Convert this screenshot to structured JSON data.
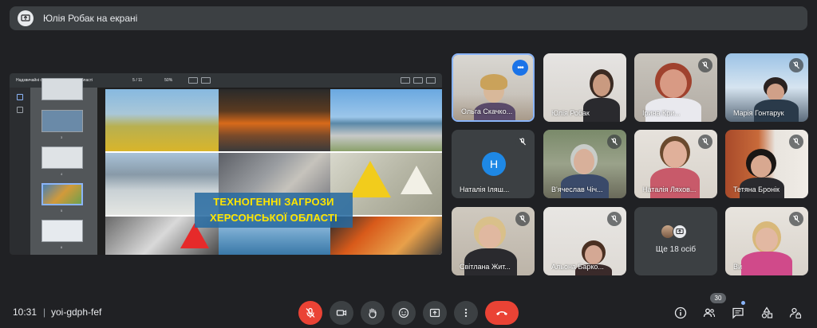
{
  "presenter": {
    "label": "Юлія Робак на екрані"
  },
  "pdf": {
    "title": "Надзвичайні ситуації херсонської області",
    "page_indicator": "5 / 11",
    "zoom": "50%",
    "thumb_numbers": [
      "3",
      "4",
      "5",
      "6"
    ]
  },
  "slide": {
    "title_line1": "ТЕХНОГЕННІ ЗАГРОЗИ",
    "title_line2": "ХЕРСОНСЬКОЇ ОБЛАСТІ"
  },
  "participants": [
    {
      "name": "Ольга Скачко...",
      "muted": false,
      "active": true
    },
    {
      "name": "Юлія Робак",
      "muted": false
    },
    {
      "name": "Ірина Кри...",
      "muted": true
    },
    {
      "name": "Марія Гонтарук",
      "muted": true
    },
    {
      "name": "Наталія Іляш...",
      "muted": true,
      "initial": "Н"
    },
    {
      "name": "В'ячеслав Чіч...",
      "muted": true
    },
    {
      "name": "Наталія Ляхов...",
      "muted": true
    },
    {
      "name": "Тетяна Бронік",
      "muted": true
    },
    {
      "name": "Світлана Жит...",
      "muted": true
    },
    {
      "name": "Альона Барко...",
      "muted": true
    },
    {
      "name": "Ви",
      "muted": true
    }
  ],
  "others": {
    "label": "Ще 18 осіб"
  },
  "meeting": {
    "time": "10:31",
    "separator": "|",
    "code": "yoi-gdph-fef"
  },
  "people_count": "30",
  "colors": {
    "accent": "#8ab4f8",
    "danger": "#ea4335",
    "surface": "#3c4043",
    "background": "#202124"
  }
}
